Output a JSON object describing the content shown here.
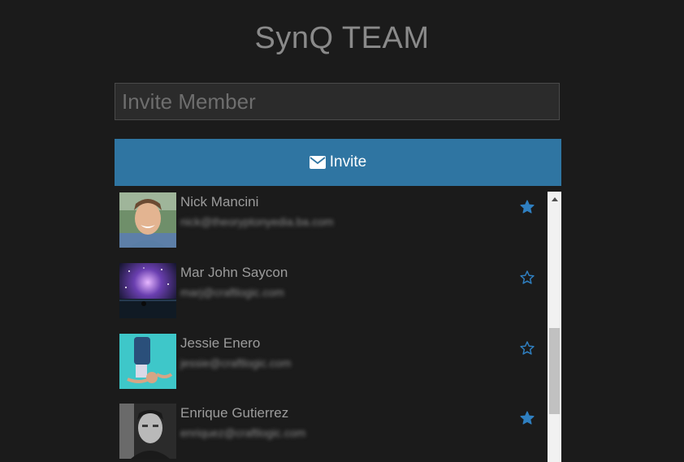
{
  "app": {
    "title": "SynQ TEAM"
  },
  "invite": {
    "placeholder": "Invite Member",
    "button_label": "Invite",
    "button_icon": "envelope-icon"
  },
  "members": [
    {
      "name": "Nick Mancini",
      "email": "nick@theoryptonyedia.ba.com",
      "starred": true
    },
    {
      "name": "Mar John Saycon",
      "email": "marj@craftlogic.com",
      "starred": false
    },
    {
      "name": "Jessie Enero",
      "email": "jessie@craftlogic.com",
      "starred": false
    },
    {
      "name": "Enrique Gutierrez",
      "email": "enriquez@craftlogic.com",
      "starred": true
    }
  ],
  "colors": {
    "background": "#1b1b1b",
    "accent": "#2f75a2",
    "star": "#2f7fc0"
  }
}
